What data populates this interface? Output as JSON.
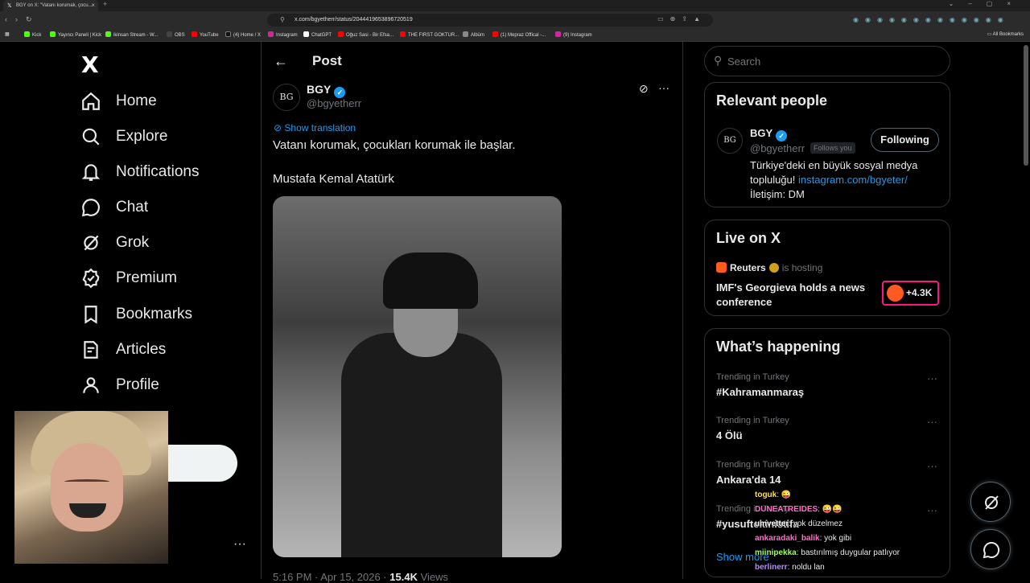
{
  "browser": {
    "tab_title": "BGY on X: \"Vatanı korumak, çocu...",
    "url": "x.com/bgyetherr/status/2044419653896720519",
    "bookmarks": [
      {
        "label": "Kick",
        "color": "#53fc18"
      },
      {
        "label": "Yayıncı Paneli | Kick",
        "color": "#53fc18"
      },
      {
        "label": "ikinsan Stream - W...",
        "color": "#53fc18"
      },
      {
        "label": "OBS",
        "color": "#444444"
      },
      {
        "label": "YouTube",
        "color": "#ff0000"
      },
      {
        "label": "(4) Home / X",
        "color": "#000000"
      },
      {
        "label": "Instagram",
        "color": "#d6249f"
      },
      {
        "label": "ChatGPT",
        "color": "#ffffff"
      },
      {
        "label": "Oğuz Sasi - Bir Efsa...",
        "color": "#ff0000"
      },
      {
        "label": "THE FIRST GOKTUR...",
        "color": "#ff0000"
      },
      {
        "label": "Albüm",
        "color": "#888888"
      },
      {
        "label": "(1) Mepraz Offical -...",
        "color": "#ff0000"
      },
      {
        "label": "(9) Instagram",
        "color": "#d6249f"
      }
    ],
    "all_bookmarks": "All Bookmarks"
  },
  "sidebar": {
    "logo": "X",
    "items": [
      {
        "label": "Home",
        "icon": "home-icon"
      },
      {
        "label": "Explore",
        "icon": "search-icon"
      },
      {
        "label": "Notifications",
        "icon": "bell-icon"
      },
      {
        "label": "Chat",
        "icon": "chat-icon"
      },
      {
        "label": "Grok",
        "icon": "grok-icon"
      },
      {
        "label": "Premium",
        "icon": "premium-icon"
      },
      {
        "label": "Bookmarks",
        "icon": "bookmark-icon"
      },
      {
        "label": "Articles",
        "icon": "articles-icon"
      },
      {
        "label": "Profile",
        "icon": "profile-icon"
      }
    ]
  },
  "header": {
    "title": "Post"
  },
  "post": {
    "author_name": "BGY",
    "author_handle": "@bgyetherr",
    "show_translation": "Show translation",
    "text_line1": "Vatanı korumak, çocukları korumak ile başlar.",
    "text_line2": "Mustafa Kemal Atatürk",
    "time": "5:16 PM · Apr 15, 2026 ·",
    "views_count": "15.4K",
    "views_label": "Views"
  },
  "search": {
    "placeholder": "Search"
  },
  "relevant_people": {
    "title": "Relevant people",
    "name": "BGY",
    "handle": "@bgyetherr",
    "follows_you": "Follows you",
    "button": "Following",
    "bio_text": "Türkiye'deki en büyük sosyal medya topluluğu! ",
    "bio_link": "instagram.com/bgyeter/",
    "bio_contact": "İletişim: DM"
  },
  "live": {
    "title": "Live on X",
    "host": "Reuters",
    "hosting": "is hosting",
    "stream_title": "IMF's Georgieva holds a news conference",
    "listeners": "+4.3K"
  },
  "happening": {
    "title": "What’s happening",
    "trends": [
      {
        "category": "Trending in Turkey",
        "name": "#Kahramanmaraş"
      },
      {
        "category": "Trending in Turkey",
        "name": "4 Ölü"
      },
      {
        "category": "Trending in Turkey",
        "name": "Ankara'da 14"
      },
      {
        "category": "Trending in Turkey",
        "name": "#yusuftekinistifa"
      }
    ],
    "show_more": "Show more"
  },
  "stream_chat": [
    {
      "user": "toguk",
      "color": "#ffde59",
      "message": "😜"
    },
    {
      "user": "DUNEATREIDES",
      "color": "#ff6ec7",
      "message": "😜😜"
    },
    {
      "user": "umvetter",
      "color": "#ffffff",
      "message": "yok düzelmez"
    },
    {
      "user": "ankaradaki_balik",
      "color": "#ff6ec7",
      "message": "yok gibi"
    },
    {
      "user": "miinipekka",
      "color": "#9cff57",
      "message": "bastırılmış duygular patlıyor"
    },
    {
      "user": "berlinerr",
      "color": "#b48cff",
      "message": "noldu lan"
    }
  ]
}
